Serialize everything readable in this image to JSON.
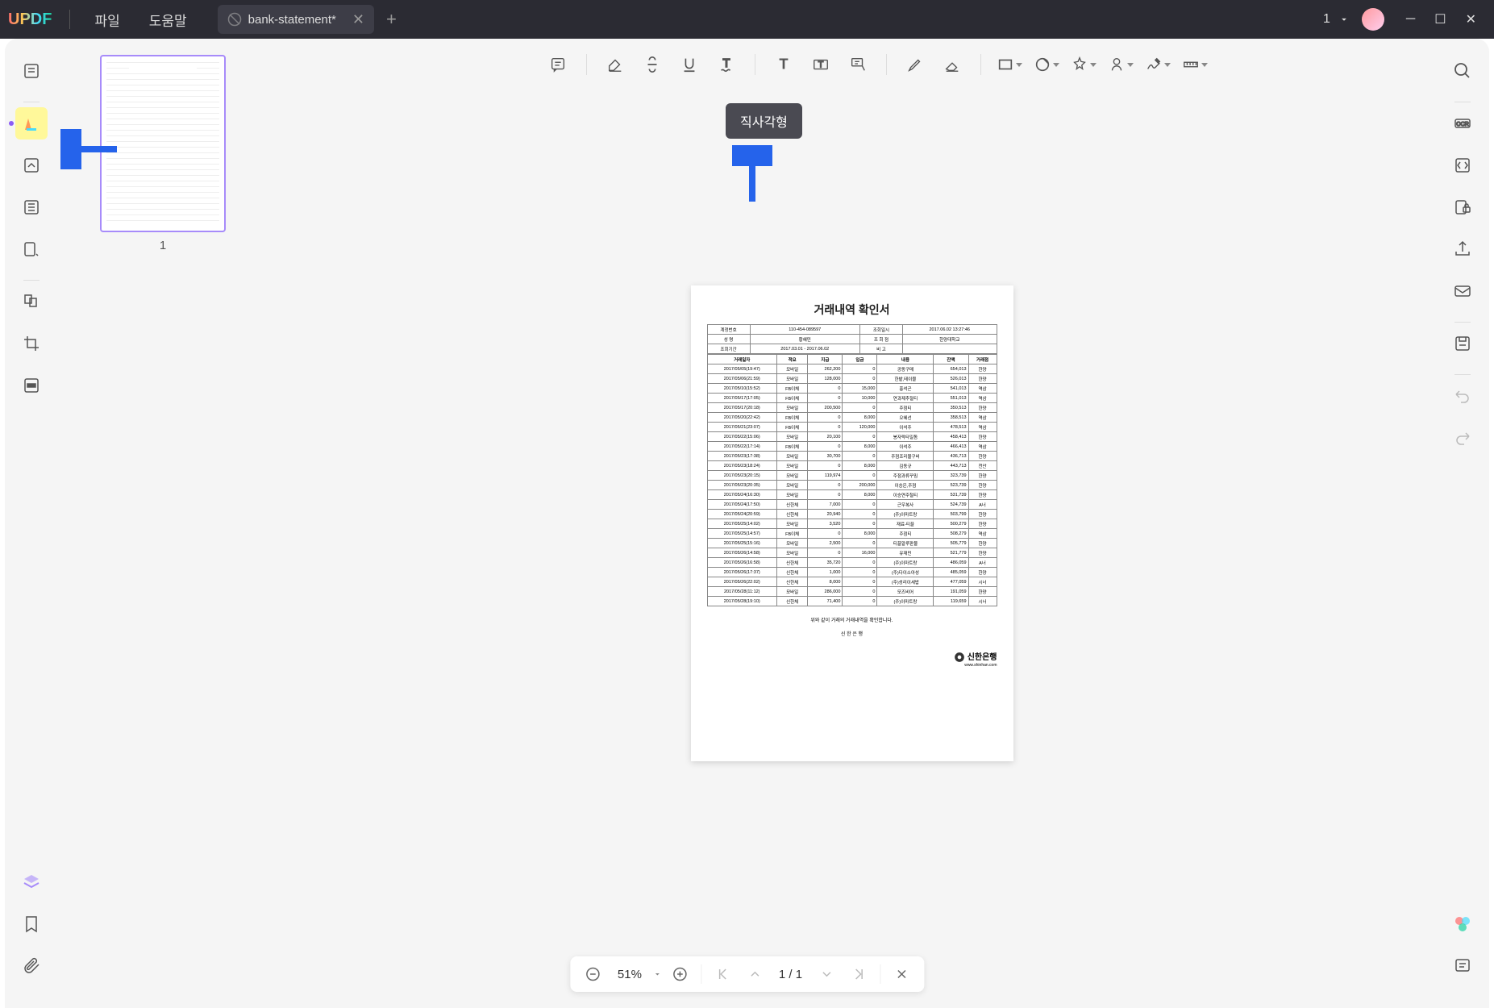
{
  "app": {
    "logo": "UPDF"
  },
  "menu": {
    "file": "파일",
    "help": "도움말"
  },
  "tab": {
    "title": "bank-statement*",
    "count": "1"
  },
  "tooltip": {
    "rectangle": "직사각형"
  },
  "thumbnails": {
    "page1_label": "1"
  },
  "page_nav": {
    "zoom": "51%",
    "current": "1",
    "total": "1",
    "separator": " / "
  },
  "document": {
    "title": "거래내역 확인서",
    "header": {
      "account_label": "계정번호",
      "account_value": "110-454-089597",
      "query_date_label": "조회일시",
      "query_date_value": "2017.06.02  13:27:46",
      "name_label": "성    명",
      "name_value": "황혜민",
      "org_label": "조 회 점",
      "org_value": "한양대학교",
      "period_label": "조회기간",
      "period_value": "2017.03.01 - 2017.06.02",
      "note_label": "비    고",
      "note_value": ""
    },
    "columns": [
      "거래일자",
      "적요",
      "지급",
      "입금",
      "내용",
      "잔액",
      "거래점"
    ],
    "rows": [
      [
        "2017/05/05(19:47)",
        "모바일",
        "262,200",
        "0",
        "공동구매",
        "654,013",
        "한양"
      ],
      [
        "2017/05/06(21:59)",
        "모바일",
        "128,000",
        "0",
        "한밭,테이블",
        "526,013",
        "한양"
      ],
      [
        "2017/05/10(15:52)",
        "FB이체",
        "0",
        "15,000",
        "홍석곤",
        "541,013",
        "역삼"
      ],
      [
        "2017/05/17(17:05)",
        "FB이체",
        "0",
        "10,000",
        "연과제추절티",
        "551,013",
        "역삼"
      ],
      [
        "2017/05/17(20:18)",
        "모바일",
        "200,500",
        "0",
        "주점티",
        "350,513",
        "한양"
      ],
      [
        "2017/05/20(22:42)",
        "FB이체",
        "0",
        "8,000",
        "오혜선",
        "358,513",
        "역삼"
      ],
      [
        "2017/05/21(23:07)",
        "FB이체",
        "0",
        "120,000",
        "이석주",
        "478,513",
        "역삼"
      ],
      [
        "2017/05/22(15:06)",
        "모바일",
        "20,100",
        "0",
        "봉자락타일돔",
        "458,413",
        "한양"
      ],
      [
        "2017/05/22(17:14)",
        "FB이체",
        "0",
        "8,000",
        "이석주",
        "466,413",
        "역삼"
      ],
      [
        "2017/05/23(17:38)",
        "모바일",
        "30,700",
        "0",
        "주점조리물구비",
        "436,713",
        "한양"
      ],
      [
        "2017/05/23(18:24)",
        "모바일",
        "0",
        "8,000",
        "김동규",
        "443,713",
        "천안"
      ],
      [
        "2017/05/23(20:15)",
        "모바일",
        "119,974",
        "0",
        "주점과류꾸밈",
        "323,739",
        "한양"
      ],
      [
        "2017/05/23(20:35)",
        "모바일",
        "0",
        "200,000",
        "이승은,주점",
        "523,739",
        "한양"
      ],
      [
        "2017/05/24(16:30)",
        "모바일",
        "0",
        "8,000",
        "이승연주철티",
        "531,739",
        "한양"
      ],
      [
        "2017/05/24(17:50)",
        "신한체",
        "7,000",
        "0",
        "근우복사",
        "524,739",
        "A너"
      ],
      [
        "2017/05/24(20:59)",
        "신한체",
        "20,940",
        "0",
        "(주)이마트랑",
        "503,799",
        "한양"
      ],
      [
        "2017/05/25(14:02)",
        "모바일",
        "3,520",
        "0",
        "재료-티끌",
        "500,279",
        "한양"
      ],
      [
        "2017/05/25(14:57)",
        "FB이체",
        "0",
        "8,000",
        "주점티",
        "508,279",
        "역삼"
      ],
      [
        "2017/05/25(15:16)",
        "모바일",
        "2,500",
        "0",
        "티끌알루판물",
        "505,779",
        "한양"
      ],
      [
        "2017/05/26(14:58)",
        "모바일",
        "0",
        "16,000",
        "유재민",
        "521,779",
        "한양"
      ],
      [
        "2017/05/26(16:58)",
        "신한체",
        "35,720",
        "0",
        "(주)이마트랑",
        "486,059",
        "A너"
      ],
      [
        "2017/05/26(17:37)",
        "신한체",
        "1,000",
        "0",
        "(주)다이소아성",
        "485,059",
        "한양"
      ],
      [
        "2017/05/26(22:02)",
        "신한체",
        "8,000",
        "0",
        "(주)성리이세밥",
        "477,059",
        "시너"
      ],
      [
        "2017/05/28(11:12)",
        "모바일",
        "286,000",
        "0",
        "모즈비어",
        "191,059",
        "한양"
      ],
      [
        "2017/05/28(19:10)",
        "신한체",
        "71,400",
        "0",
        "(주)이마트랑",
        "119,659",
        "시너"
      ]
    ],
    "footer_note": "위와 같이 거래의 거래내역을 확인합니다.",
    "bank_name_center": "신 한 은 행",
    "bank_name_right": "신한은행",
    "bank_url": "www.shinhan.com"
  }
}
